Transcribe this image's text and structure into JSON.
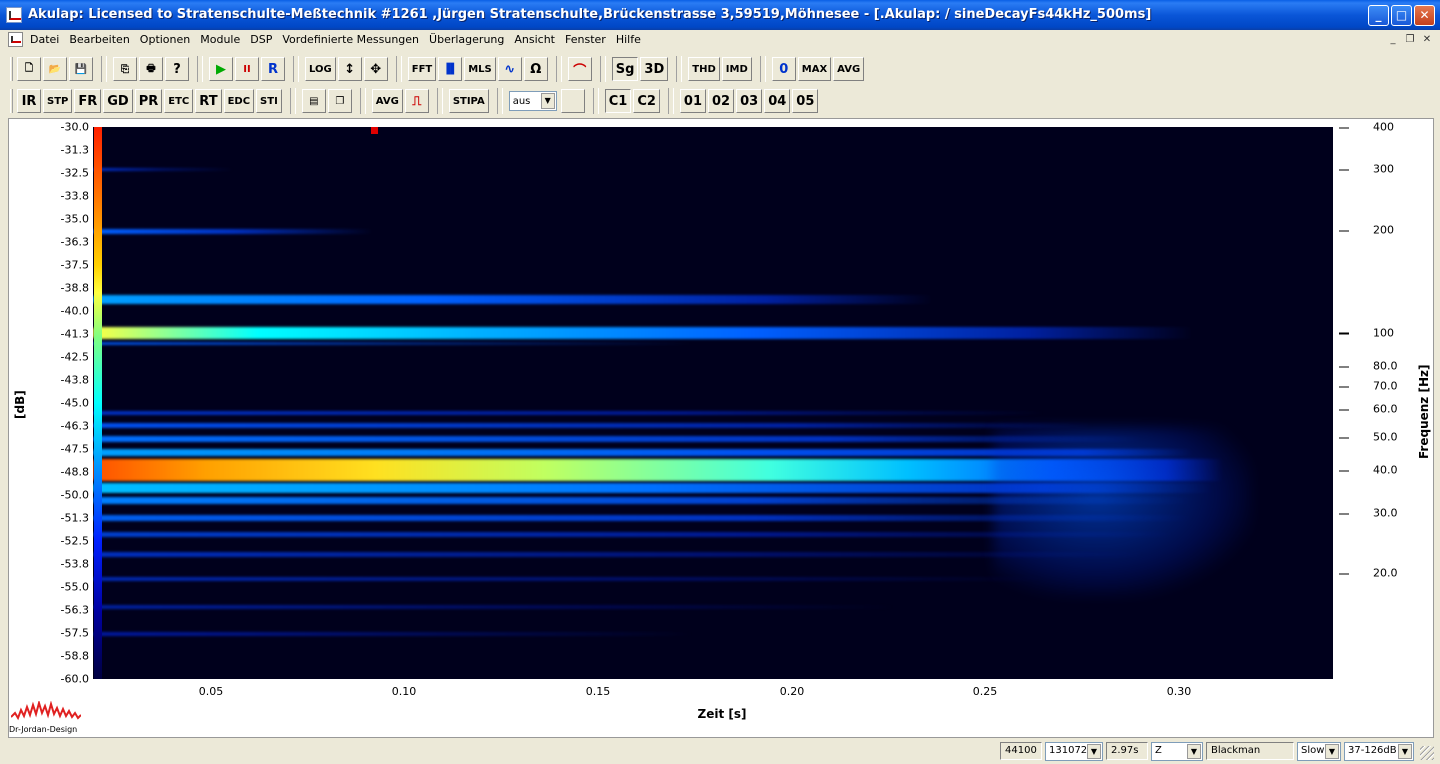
{
  "window": {
    "title": "Akulap: Licensed to Stratenschulte-Meßtechnik #1261 ,Jürgen Stratenschulte,Brückenstrasse 3,59519,Möhnesee - [.Akulap: / sineDecayFs44kHz_500ms]",
    "minimize": "_",
    "maximize": "□",
    "close": "✕"
  },
  "menu": [
    "Datei",
    "Bearbeiten",
    "Optionen",
    "Module",
    "DSP",
    "Vordefinierte Messungen",
    "Überlagerung",
    "Ansicht",
    "Fenster",
    "Hilfe"
  ],
  "toolbar1": {
    "new": "🗋",
    "open": "📂",
    "save": "💾",
    "copy": "⎘",
    "print": "🖶",
    "help": "?",
    "play": "▶",
    "pause": "II",
    "rec": "R",
    "log": "LOG",
    "vzoom": "↕",
    "pan": "✥",
    "fft": "FFT",
    "bars": "▐▌",
    "mls": "MLS",
    "wave": "∿",
    "ohm": "Ω",
    "curve": "⌒",
    "sg": "Sg",
    "d3": "3D",
    "thd": "THD",
    "imd": "IMD",
    "zero": "0",
    "max": "MAX",
    "avg": "AVG"
  },
  "toolbar2": {
    "buttons": [
      "IR",
      "STP",
      "FR",
      "GD",
      "PR",
      "ETC",
      "RT",
      "EDC",
      "STI"
    ],
    "avg": "AVG",
    "stipa": "STIPA",
    "combo_value": "aus",
    "c1": "C1",
    "c2": "C2",
    "slots": [
      "01",
      "02",
      "03",
      "04",
      "05"
    ]
  },
  "plot": {
    "ylabel": "[dB]",
    "xlabel": "Zeit [s]",
    "rlabel": "Frequenz [Hz]",
    "db_ticks": [
      "-30.0",
      "-31.3",
      "-32.5",
      "-33.8",
      "-35.0",
      "-36.3",
      "-37.5",
      "-38.8",
      "-40.0",
      "-41.3",
      "-42.5",
      "-43.8",
      "-45.0",
      "-46.3",
      "-47.5",
      "-48.8",
      "-50.0",
      "-51.3",
      "-52.5",
      "-53.8",
      "-55.0",
      "-56.3",
      "-57.5",
      "-58.8",
      "-60.0"
    ],
    "time_ticks": [
      "0.05",
      "0.10",
      "0.15",
      "0.20",
      "0.25",
      "0.30"
    ],
    "freq_ticks": [
      "400",
      "300",
      "200",
      "100",
      "80.0",
      "70.0",
      "60.0",
      "50.0",
      "40.0",
      "30.0",
      "20.0"
    ],
    "logo_text": "Dr-Jordan-Design"
  },
  "chart_data": {
    "type": "heatmap",
    "title": "",
    "xlabel": "Zeit [s]",
    "ylabel": "Frequenz [Hz]",
    "colorbar_label": "[dB]",
    "colorbar_range": [
      -60.0,
      -30.0
    ],
    "xlim": [
      0.02,
      0.34
    ],
    "x_ticks": [
      0.05,
      0.1,
      0.15,
      0.2,
      0.25,
      0.3
    ],
    "y_scale": "log",
    "y_ticks": [
      400,
      300,
      200,
      100,
      80,
      70,
      60,
      50,
      40,
      30,
      20
    ],
    "dominant_components": [
      {
        "frequency_hz": 40,
        "level_db": -31,
        "decay_end_s": 0.26
      },
      {
        "frequency_hz": 100,
        "level_db": -40,
        "decay_end_s": 0.31
      },
      {
        "frequency_hz": 120,
        "level_db": -45,
        "decay_end_s": 0.2
      },
      {
        "frequency_hz": 200,
        "level_db": -52,
        "decay_end_s": 0.08
      },
      {
        "frequency_hz": 300,
        "level_db": -56,
        "decay_end_s": 0.05
      }
    ]
  },
  "status": {
    "fs": "44100",
    "fft_size": "131072",
    "duration": "2.97s",
    "weighting": "Z",
    "window": "Blackman",
    "speed": "Slow",
    "range": "37-126dB"
  }
}
